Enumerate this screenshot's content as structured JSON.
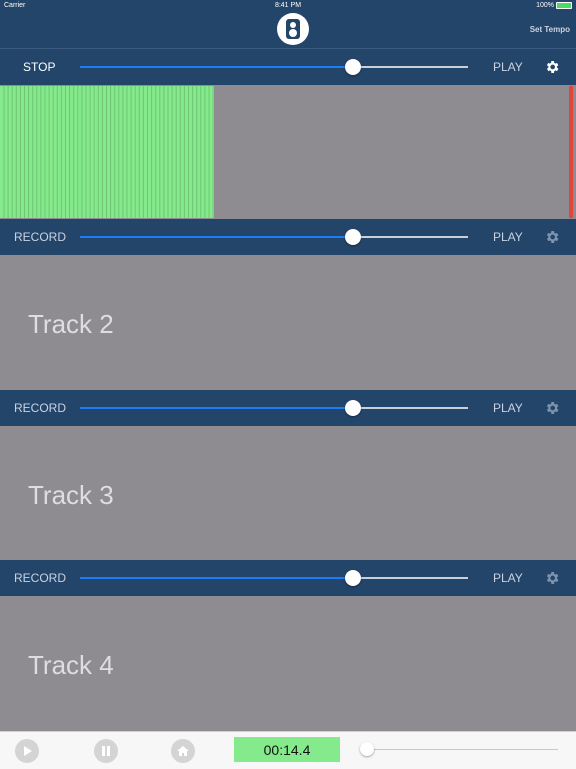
{
  "status_bar": {
    "carrier": "Carrier",
    "time": "8:41 PM",
    "battery": "100%"
  },
  "navbar": {
    "app_icon": "speaker-icon",
    "set_tempo_label": "Set Tempo"
  },
  "tracks": [
    {
      "action_label": "STOP",
      "play_label": "PLAY",
      "volume": 0.7,
      "name": "",
      "recording": true
    },
    {
      "action_label": "RECORD",
      "play_label": "PLAY",
      "volume": 0.7,
      "name": "Track 2"
    },
    {
      "action_label": "RECORD",
      "play_label": "PLAY",
      "volume": 0.7,
      "name": "Track 3"
    },
    {
      "action_label": "RECORD",
      "play_label": "PLAY",
      "volume": 0.7,
      "name": "Track 4"
    }
  ],
  "transport": {
    "play_icon": "play-icon",
    "pause_icon": "pause-icon",
    "home_icon": "home-icon",
    "timer": "00:14.4",
    "position": 0.0
  },
  "colors": {
    "bar": "#24456a",
    "accent": "#1c7cf4",
    "wave": "#85ea8b",
    "playhead": "#e0463a",
    "track_bg": "#8e8c91"
  }
}
